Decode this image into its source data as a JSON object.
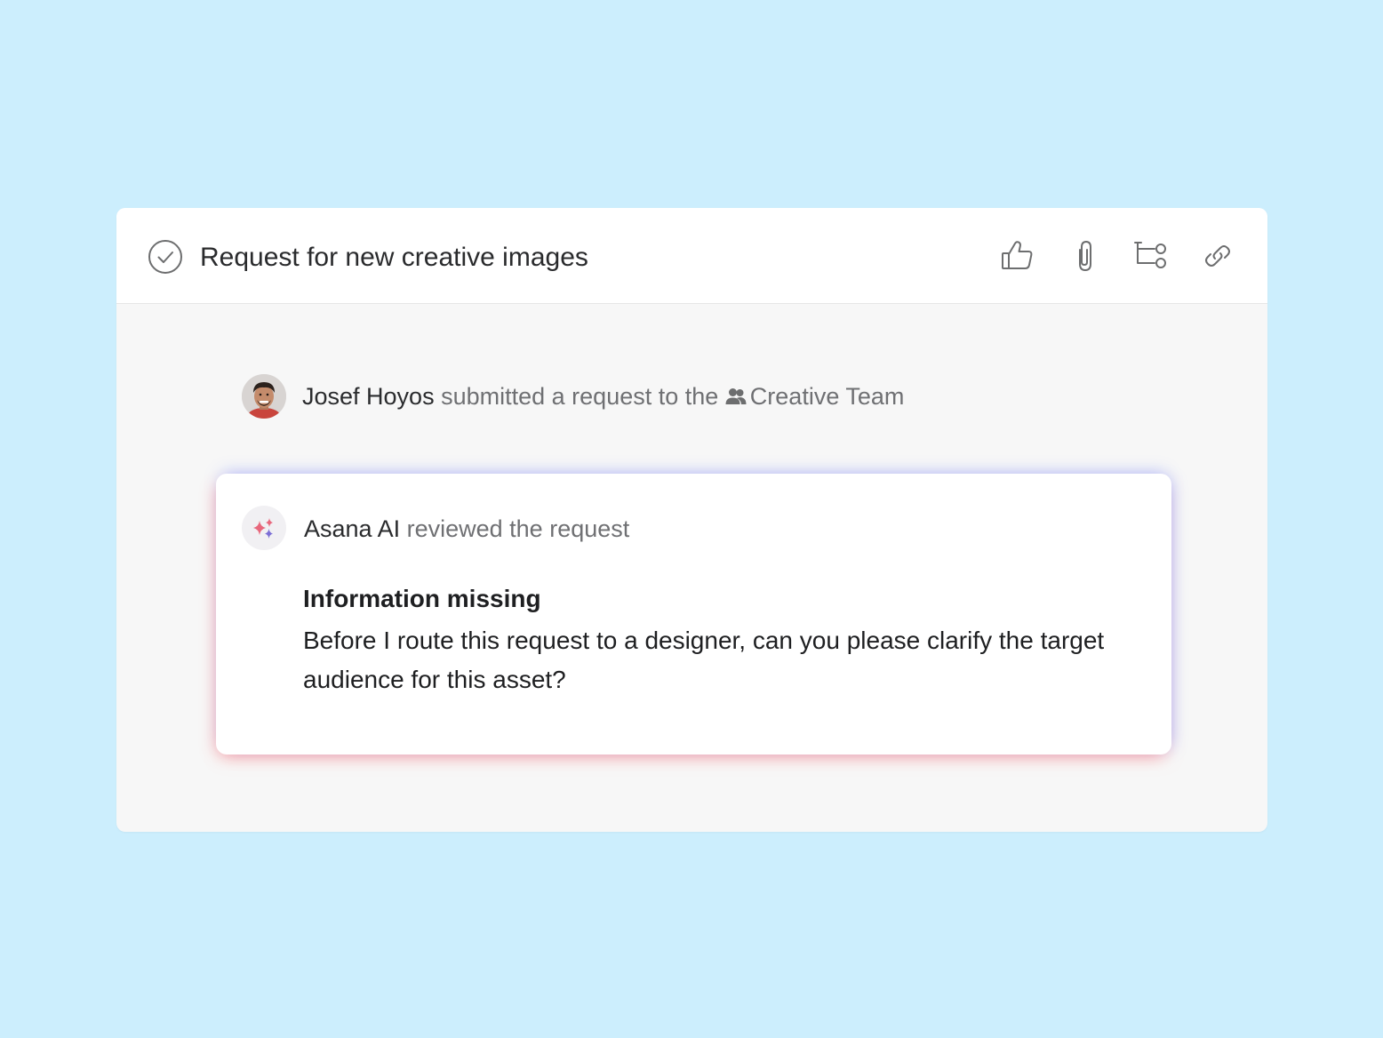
{
  "task": {
    "title": "Request for new creative images",
    "toolbar": {
      "like_icon": "thumbs-up-icon",
      "attach_icon": "paperclip-icon",
      "subtask_icon": "subtask-icon",
      "link_icon": "link-icon"
    }
  },
  "activity": {
    "author": "Josef Hoyos",
    "action": "submitted a request to the",
    "team": "Creative Team"
  },
  "ai_review": {
    "author": "Asana AI",
    "action": "reviewed the request",
    "heading": "Information missing",
    "body": "Before I route this request to a designer, can you please clarify the target audience for this asset?"
  },
  "colors": {
    "background": "#cceefd",
    "panel": "#f7f7f7",
    "card": "#ffffff",
    "sparkle_pink": "#e8677c",
    "sparkle_purple": "#7c6fd6"
  }
}
